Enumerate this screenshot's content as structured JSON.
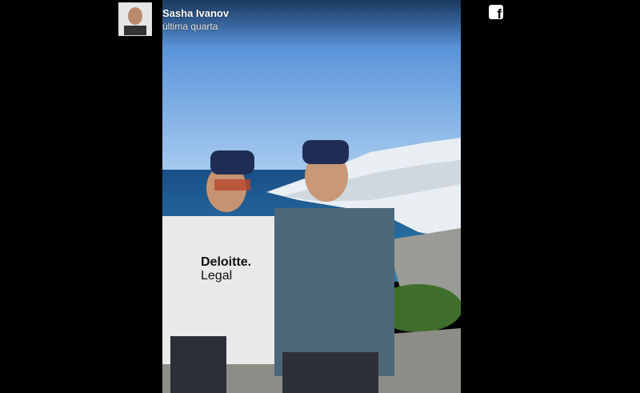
{
  "post": {
    "author_name": "Sasha Ivanov",
    "timestamp": "última quarta",
    "photo_alt": "",
    "shirt_text_line1": "Deloitte.",
    "shirt_text_line2": "Legal"
  },
  "icons": {
    "share": "facebook-icon",
    "share_glyph": "f"
  },
  "colors": {
    "background": "#000000",
    "sky": "#6fb0e8",
    "sea": "#1f5d8f"
  }
}
